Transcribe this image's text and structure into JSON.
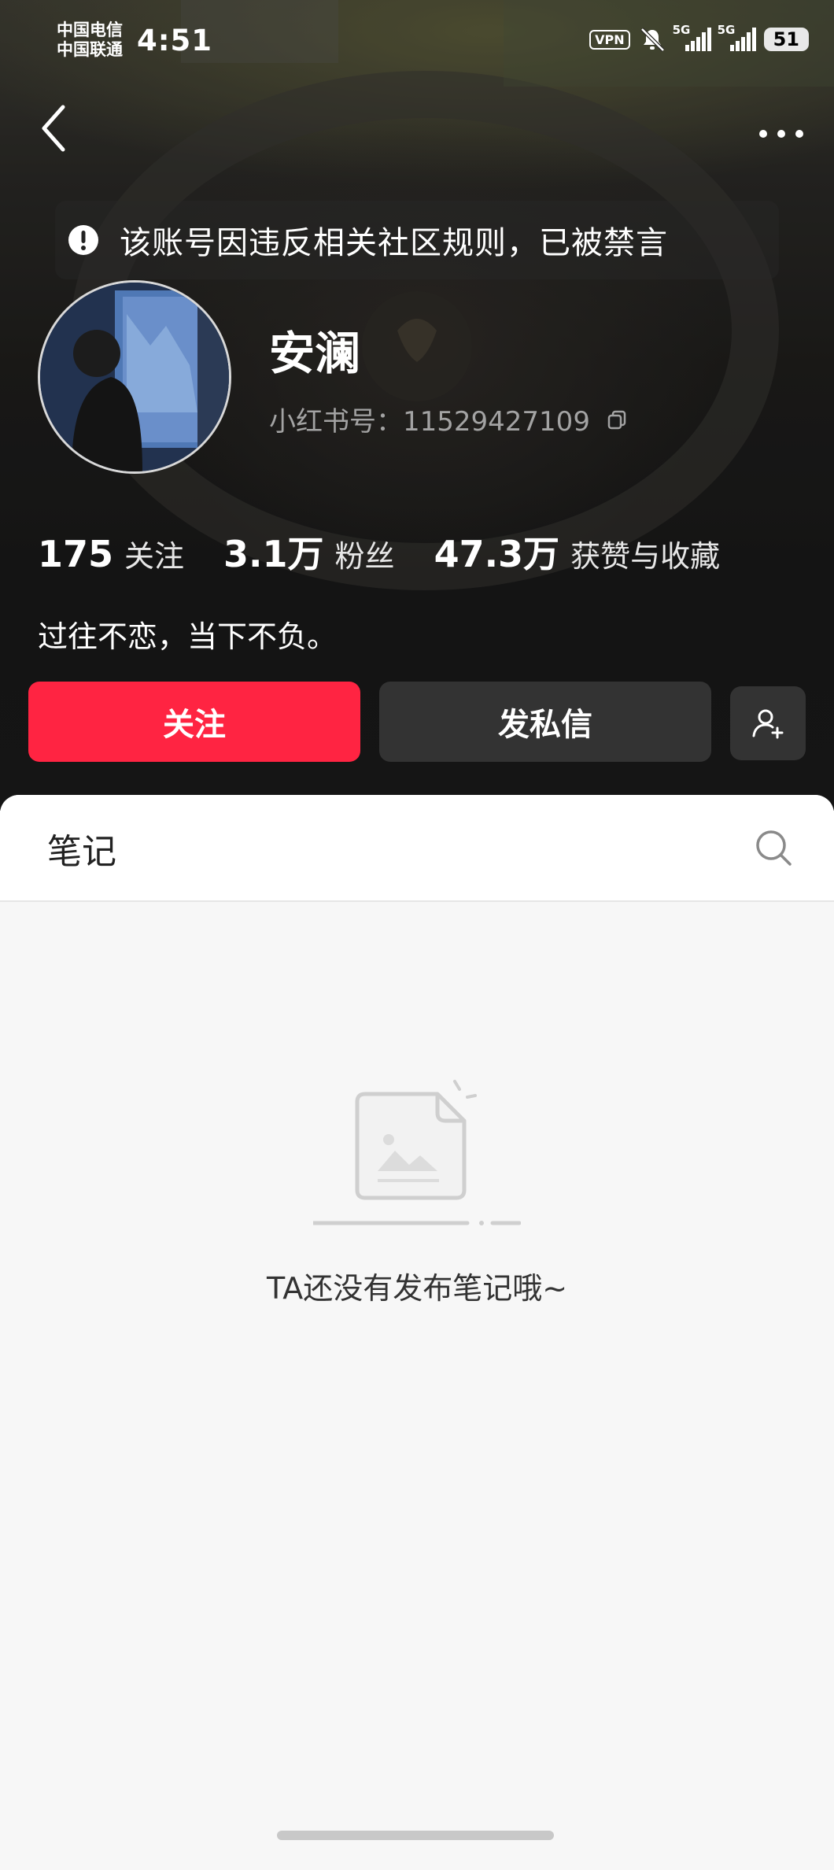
{
  "status_bar": {
    "carrier_1": "中国电信",
    "carrier_2": "中国联通",
    "time": "4:51",
    "vpn": "VPN",
    "network_1": "5G",
    "network_2": "5G",
    "battery": "51"
  },
  "notice": {
    "text": "该账号因违反相关社区规则，已被禁言",
    "icon": "alert-icon"
  },
  "profile": {
    "name": "安澜",
    "id_label": "小红书号：",
    "id_value": "11529427109",
    "bio": "过往不恋，当下不负。"
  },
  "stats": [
    {
      "value": "175",
      "label": "关注"
    },
    {
      "value": "3.1万",
      "label": "粉丝"
    },
    {
      "value": "47.3万",
      "label": "获赞与收藏"
    }
  ],
  "actions": {
    "follow": "关注",
    "message": "发私信"
  },
  "tabs": {
    "notes": "笔记"
  },
  "empty_state": {
    "text": "TA还没有发布笔记哦~"
  },
  "colors": {
    "accent": "#ff2442",
    "button_dark": "#333333",
    "sheet_bg": "#f7f7f7"
  }
}
